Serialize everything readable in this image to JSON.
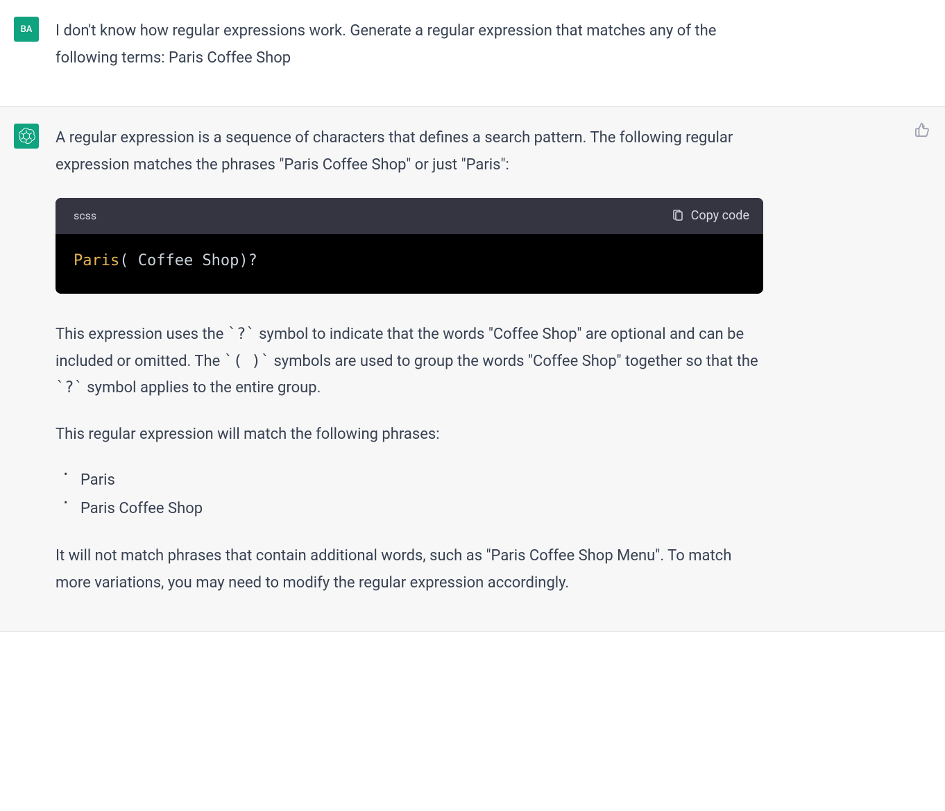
{
  "user": {
    "avatar_text": "BA",
    "message": "I don't know how regular expressions work. Generate a regular expression that matches any of the following terms: Paris Coffee Shop"
  },
  "assistant": {
    "intro": "A regular expression is a sequence of characters that defines a search pattern. The following regular expression matches the phrases \"Paris Coffee Shop\" or just \"Paris\":",
    "code_block": {
      "language": "scss",
      "copy_label": "Copy code",
      "token_fn": "Paris",
      "token_rest": "( Coffee Shop)?"
    },
    "explanation_1_a": "This expression uses the ",
    "explanation_1_code1": "`?`",
    "explanation_1_b": " symbol to indicate that the words \"Coffee Shop\" are optional and can be included or omitted. The ",
    "explanation_1_code2": "`( )`",
    "explanation_1_c": " symbols are used to group the words \"Coffee Shop\" together so that the ",
    "explanation_1_code3": "`?`",
    "explanation_1_d": " symbol applies to the entire group.",
    "explanation_2": "This regular expression will match the following phrases:",
    "match_list": [
      "Paris",
      "Paris Coffee Shop"
    ],
    "explanation_3": "It will not match phrases that contain additional words, such as \"Paris Coffee Shop Menu\". To match more variations, you may need to modify the regular expression accordingly."
  }
}
